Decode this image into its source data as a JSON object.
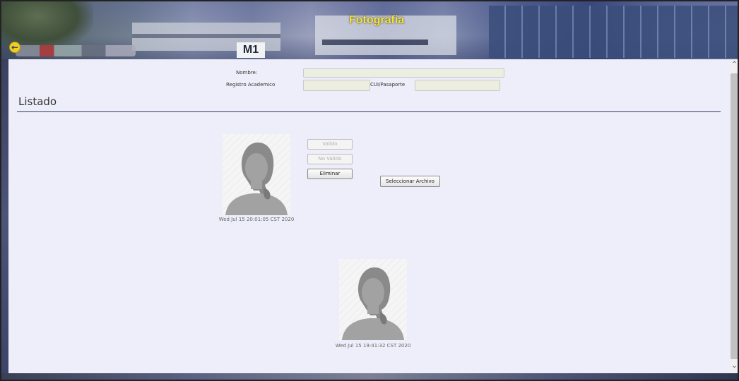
{
  "header": {
    "title": "Fotografia",
    "sign_text": "M1"
  },
  "form": {
    "nombre_label": "Nombre:",
    "registro_label": "Registro Academico",
    "cui_label": "CUI/Pasaporte",
    "nombre_value": "",
    "registro_value": "",
    "cui_value": ""
  },
  "listado": {
    "title": "Listado",
    "items": [
      {
        "timestamp": "Wed Jul 15 20:01:05 CST 2020"
      },
      {
        "timestamp": "Wed Jul 15 19:41:32 CST 2020"
      }
    ]
  },
  "actions": {
    "valido_label": "Valido",
    "no_valido_label": "No Valido",
    "eliminar_label": "Eliminar",
    "seleccionar_label": "Seleccionar Archivo"
  },
  "icons": {
    "back": "arrow-left-icon",
    "scroll_up": "chevron-up-icon",
    "scroll_down": "chevron-down-icon",
    "avatar": "female-avatar-icon"
  },
  "colors": {
    "title": "#f2e23a",
    "panel": "#eeeefa",
    "rule": "#2e3a5e",
    "back_button": "#f0d020"
  }
}
